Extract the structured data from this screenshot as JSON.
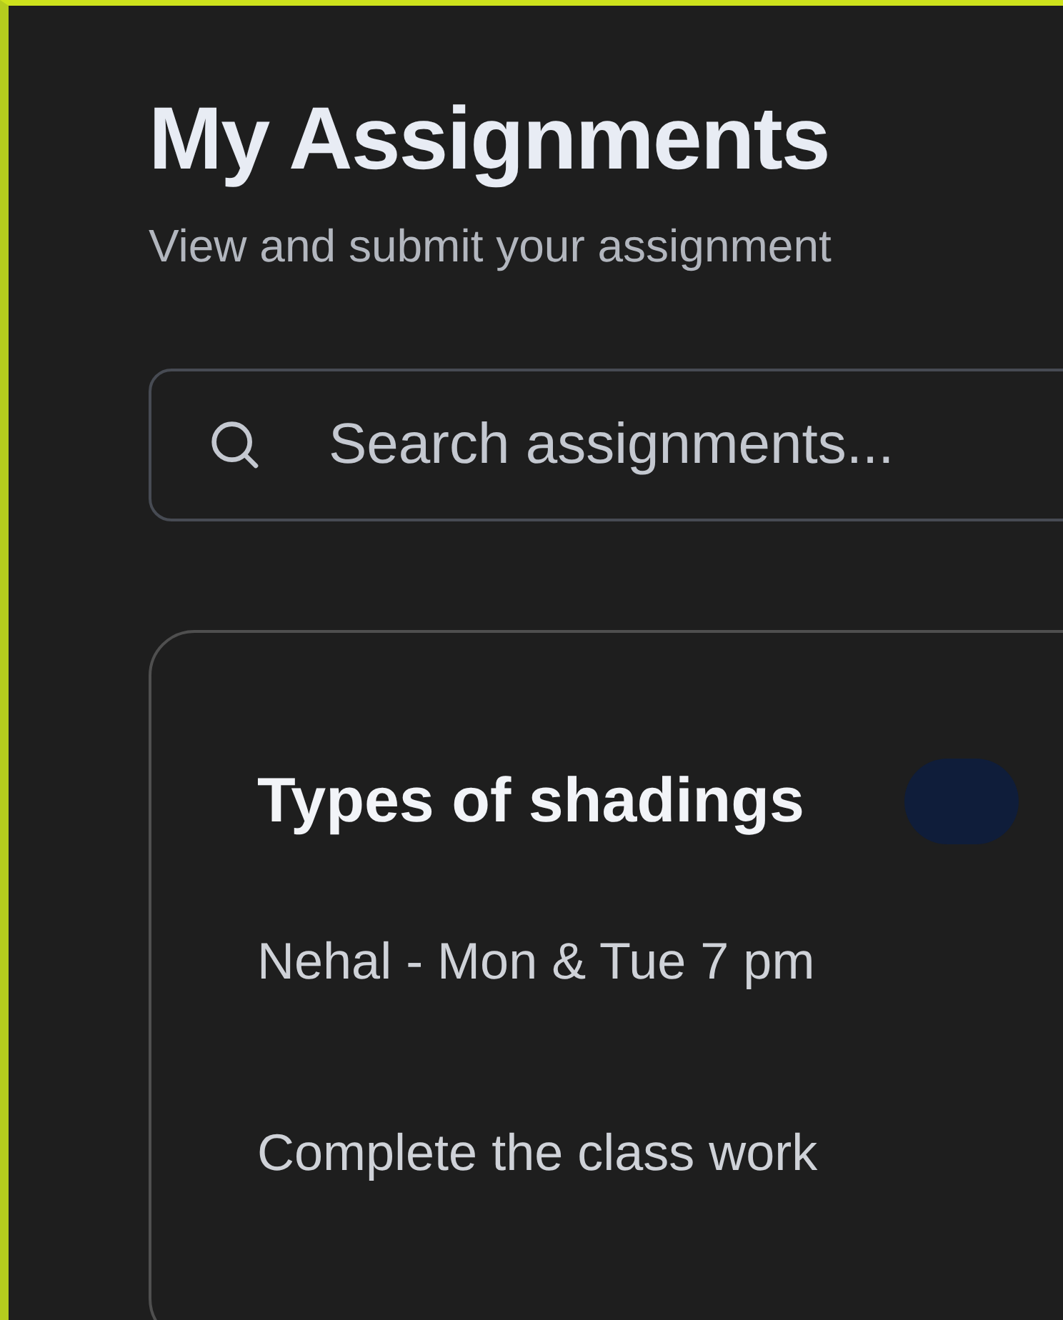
{
  "header": {
    "title": "My Assignments",
    "subtitle": "View and submit your assignment"
  },
  "search": {
    "placeholder": "Search assignments..."
  },
  "assignments": [
    {
      "title": "Types of shadings",
      "teacher": "Nehal - Mon & Tue 7 pm",
      "description": "Complete the class work"
    }
  ]
}
